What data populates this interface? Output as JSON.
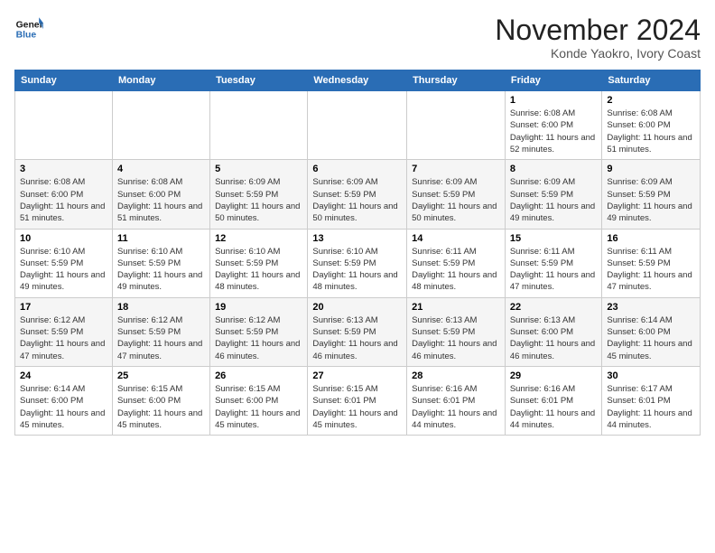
{
  "header": {
    "logo_line1": "General",
    "logo_line2": "Blue",
    "month_title": "November 2024",
    "location": "Konde Yaokro, Ivory Coast"
  },
  "days_of_week": [
    "Sunday",
    "Monday",
    "Tuesday",
    "Wednesday",
    "Thursday",
    "Friday",
    "Saturday"
  ],
  "weeks": [
    [
      {
        "day": "",
        "info": ""
      },
      {
        "day": "",
        "info": ""
      },
      {
        "day": "",
        "info": ""
      },
      {
        "day": "",
        "info": ""
      },
      {
        "day": "",
        "info": ""
      },
      {
        "day": "1",
        "info": "Sunrise: 6:08 AM\nSunset: 6:00 PM\nDaylight: 11 hours and 52 minutes."
      },
      {
        "day": "2",
        "info": "Sunrise: 6:08 AM\nSunset: 6:00 PM\nDaylight: 11 hours and 51 minutes."
      }
    ],
    [
      {
        "day": "3",
        "info": "Sunrise: 6:08 AM\nSunset: 6:00 PM\nDaylight: 11 hours and 51 minutes."
      },
      {
        "day": "4",
        "info": "Sunrise: 6:08 AM\nSunset: 6:00 PM\nDaylight: 11 hours and 51 minutes."
      },
      {
        "day": "5",
        "info": "Sunrise: 6:09 AM\nSunset: 5:59 PM\nDaylight: 11 hours and 50 minutes."
      },
      {
        "day": "6",
        "info": "Sunrise: 6:09 AM\nSunset: 5:59 PM\nDaylight: 11 hours and 50 minutes."
      },
      {
        "day": "7",
        "info": "Sunrise: 6:09 AM\nSunset: 5:59 PM\nDaylight: 11 hours and 50 minutes."
      },
      {
        "day": "8",
        "info": "Sunrise: 6:09 AM\nSunset: 5:59 PM\nDaylight: 11 hours and 49 minutes."
      },
      {
        "day": "9",
        "info": "Sunrise: 6:09 AM\nSunset: 5:59 PM\nDaylight: 11 hours and 49 minutes."
      }
    ],
    [
      {
        "day": "10",
        "info": "Sunrise: 6:10 AM\nSunset: 5:59 PM\nDaylight: 11 hours and 49 minutes."
      },
      {
        "day": "11",
        "info": "Sunrise: 6:10 AM\nSunset: 5:59 PM\nDaylight: 11 hours and 49 minutes."
      },
      {
        "day": "12",
        "info": "Sunrise: 6:10 AM\nSunset: 5:59 PM\nDaylight: 11 hours and 48 minutes."
      },
      {
        "day": "13",
        "info": "Sunrise: 6:10 AM\nSunset: 5:59 PM\nDaylight: 11 hours and 48 minutes."
      },
      {
        "day": "14",
        "info": "Sunrise: 6:11 AM\nSunset: 5:59 PM\nDaylight: 11 hours and 48 minutes."
      },
      {
        "day": "15",
        "info": "Sunrise: 6:11 AM\nSunset: 5:59 PM\nDaylight: 11 hours and 47 minutes."
      },
      {
        "day": "16",
        "info": "Sunrise: 6:11 AM\nSunset: 5:59 PM\nDaylight: 11 hours and 47 minutes."
      }
    ],
    [
      {
        "day": "17",
        "info": "Sunrise: 6:12 AM\nSunset: 5:59 PM\nDaylight: 11 hours and 47 minutes."
      },
      {
        "day": "18",
        "info": "Sunrise: 6:12 AM\nSunset: 5:59 PM\nDaylight: 11 hours and 47 minutes."
      },
      {
        "day": "19",
        "info": "Sunrise: 6:12 AM\nSunset: 5:59 PM\nDaylight: 11 hours and 46 minutes."
      },
      {
        "day": "20",
        "info": "Sunrise: 6:13 AM\nSunset: 5:59 PM\nDaylight: 11 hours and 46 minutes."
      },
      {
        "day": "21",
        "info": "Sunrise: 6:13 AM\nSunset: 5:59 PM\nDaylight: 11 hours and 46 minutes."
      },
      {
        "day": "22",
        "info": "Sunrise: 6:13 AM\nSunset: 6:00 PM\nDaylight: 11 hours and 46 minutes."
      },
      {
        "day": "23",
        "info": "Sunrise: 6:14 AM\nSunset: 6:00 PM\nDaylight: 11 hours and 45 minutes."
      }
    ],
    [
      {
        "day": "24",
        "info": "Sunrise: 6:14 AM\nSunset: 6:00 PM\nDaylight: 11 hours and 45 minutes."
      },
      {
        "day": "25",
        "info": "Sunrise: 6:15 AM\nSunset: 6:00 PM\nDaylight: 11 hours and 45 minutes."
      },
      {
        "day": "26",
        "info": "Sunrise: 6:15 AM\nSunset: 6:00 PM\nDaylight: 11 hours and 45 minutes."
      },
      {
        "day": "27",
        "info": "Sunrise: 6:15 AM\nSunset: 6:01 PM\nDaylight: 11 hours and 45 minutes."
      },
      {
        "day": "28",
        "info": "Sunrise: 6:16 AM\nSunset: 6:01 PM\nDaylight: 11 hours and 44 minutes."
      },
      {
        "day": "29",
        "info": "Sunrise: 6:16 AM\nSunset: 6:01 PM\nDaylight: 11 hours and 44 minutes."
      },
      {
        "day": "30",
        "info": "Sunrise: 6:17 AM\nSunset: 6:01 PM\nDaylight: 11 hours and 44 minutes."
      }
    ]
  ]
}
